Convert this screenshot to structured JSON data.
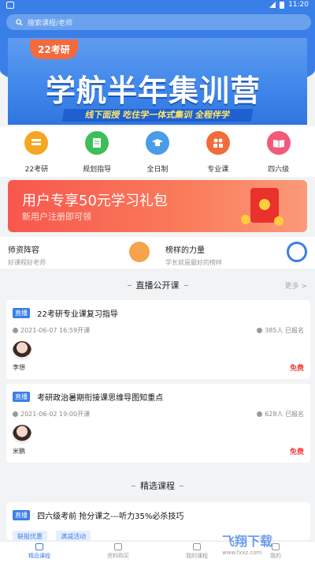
{
  "colors": {
    "primary": "#3a7ee8",
    "free": "#f2413b",
    "promo_start": "#f7574e",
    "promo_end": "#fb9a79"
  },
  "status": {
    "time": "11:20"
  },
  "search": {
    "placeholder": "搜索课程/老师"
  },
  "banner": {
    "tag": "22考研",
    "title": "学航半年集训营",
    "subtitle": "线下面授 吃住学一体式集训 全程伴学"
  },
  "quick_nav": [
    {
      "label": "22考研",
      "color": "#f5a623",
      "icon": "book-icon"
    },
    {
      "label": "规划指导",
      "color": "#3cbf5a",
      "icon": "document-icon"
    },
    {
      "label": "全日制",
      "color": "#4a9be8",
      "icon": "graduation-cap-icon"
    },
    {
      "label": "专业课",
      "color": "#f26b3a",
      "icon": "people-icon"
    },
    {
      "label": "四六级",
      "color": "#f25a7a",
      "icon": "open-book-icon"
    }
  ],
  "promo": {
    "title": "用户专享50元学习礼包",
    "subtitle": "新用户注册即可领"
  },
  "teachers": {
    "title": "师资阵容",
    "subtitle": "好课程好老师"
  },
  "models": {
    "title": "榜样的力量",
    "subtitle": "学长就是最好的榜样"
  },
  "live_section": {
    "title": "直播公开课",
    "more": "更多 >"
  },
  "live_courses": [
    {
      "badge": "直播",
      "title": "22考研专业课复习指导",
      "time": "2021-06-07 16:59开课",
      "signed": "385人 已报名",
      "teacher": "李想",
      "price": "免费"
    },
    {
      "badge": "直播",
      "title": "考研政治暑期衔接课思维导图知重点",
      "time": "2021-06-02 19:00开课",
      "signed": "628人 已报名",
      "teacher": "米鹏",
      "price": "免费"
    }
  ],
  "featured_section": {
    "title": "精选课程"
  },
  "featured_course": {
    "badge": "直播",
    "title": "四六级考前 抢分课之---听力35%必杀技巧",
    "tags": [
      "联报优惠",
      "满减活动"
    ]
  },
  "bottom_nav": [
    {
      "label": "精品课程",
      "active": true
    },
    {
      "label": "资料购买",
      "active": false
    },
    {
      "label": "我的课程",
      "active": false
    },
    {
      "label": "我的",
      "active": false
    }
  ],
  "watermark": {
    "brand": "飞翔下载",
    "url": "www.fxxz.com"
  }
}
